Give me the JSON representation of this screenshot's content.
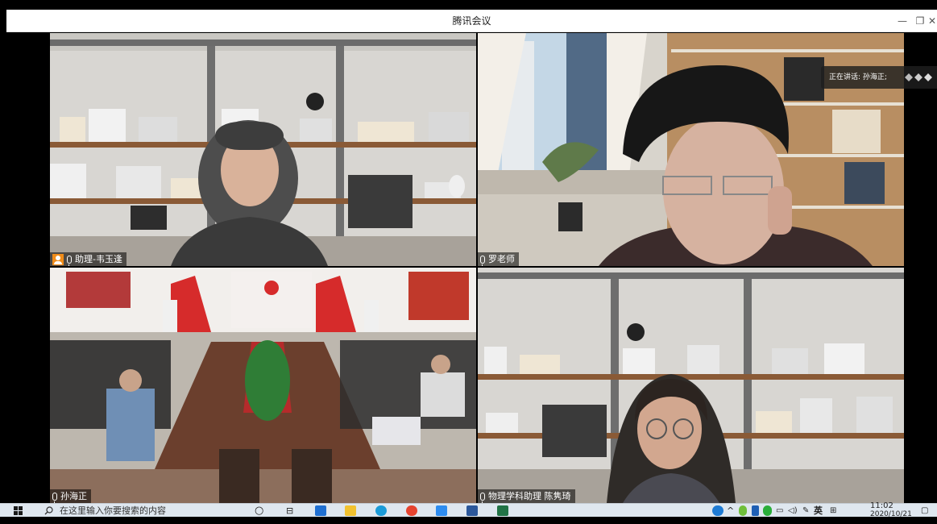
{
  "window": {
    "title": "腾讯会议",
    "minimize": "—",
    "restore": "❐"
  },
  "speaking_banner": "正在讲话: 孙海正;",
  "participants": [
    {
      "name": "助理-韦玉逢",
      "assistant": true
    },
    {
      "name": "罗老师"
    },
    {
      "name": "孙海正"
    },
    {
      "name": "物理学科助理 陈隽琦"
    }
  ],
  "taskbar": {
    "search_placeholder": "在这里输入你要搜索的内容",
    "ime_label": "英",
    "time": "11:02",
    "date": "2020/10/21"
  },
  "colors": {
    "active_border": "#2ecc71",
    "assistant_badge": "#f08c1a"
  }
}
